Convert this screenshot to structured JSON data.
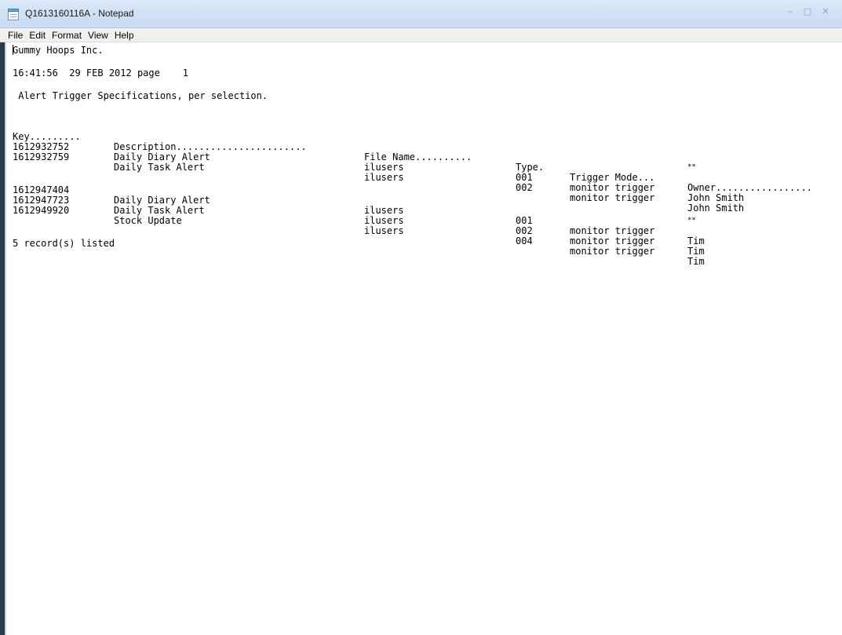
{
  "window": {
    "title": "Q1613160116A - Notepad",
    "controls": {
      "minimize": "–",
      "maximize": "□",
      "close": "✕"
    },
    "icon": "notepad-icon"
  },
  "menu": {
    "items": [
      "File",
      "Edit",
      "Format",
      "View",
      "Help"
    ]
  },
  "document": {
    "company": "Gummy Hoops Inc.",
    "timestamp_line": "16:41:56  29 FEB 2012 page    1",
    "report_title": " Alert Trigger Specifications, per selection.",
    "headers": {
      "key": "Key.........",
      "description": "Description.......................",
      "file_name": "File Name..........",
      "type": "Type.",
      "trigger_mode": "Trigger Mode...",
      "owner": "Owner................."
    },
    "groups": [
      {
        "rows": [
          {
            "key": "1612932752",
            "description": "Daily Diary Alert",
            "file_name": "ilusers",
            "type": "001",
            "trigger_mode": "monitor trigger",
            "owner": "John Smith"
          },
          {
            "key": "1612932759",
            "description": "Daily Task Alert",
            "file_name": "ilusers",
            "type": "002",
            "trigger_mode": "monitor trigger",
            "owner": "John Smith"
          }
        ],
        "subtotal_marker": "**"
      },
      {
        "rows": [
          {
            "key": "1612947404",
            "description": "Daily Diary Alert",
            "file_name": "ilusers",
            "type": "001",
            "trigger_mode": "monitor trigger",
            "owner": "Tim"
          },
          {
            "key": "1612947723",
            "description": "Daily Task Alert",
            "file_name": "ilusers",
            "type": "002",
            "trigger_mode": "monitor trigger",
            "owner": "Tim"
          },
          {
            "key": "1612949920",
            "description": "Stock Update",
            "file_name": "ilusers",
            "type": "004",
            "trigger_mode": "monitor trigger",
            "owner": "Tim"
          }
        ],
        "subtotal_marker": "**"
      }
    ],
    "footer": "5 record(s) listed"
  }
}
